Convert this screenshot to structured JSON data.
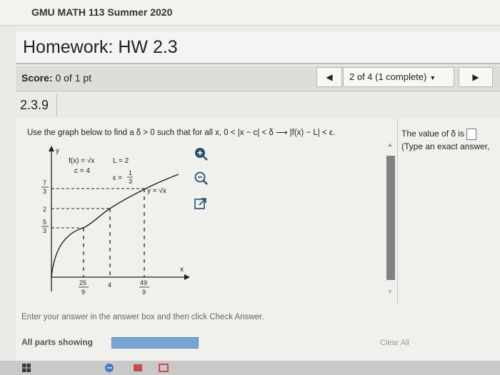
{
  "course": {
    "title": "GMU MATH 113 Summer 2020"
  },
  "homework": {
    "title": "Homework: HW 2.3"
  },
  "score": {
    "label": "Score:",
    "value": "0 of 1 pt",
    "progress_text": "2 of 4 (1 complete)"
  },
  "question": {
    "number": "2.3.9",
    "instruction": "Use the graph below to find a δ > 0 such that for all x, 0 < |x − c| < δ ⟶ |f(x) − L| < ε."
  },
  "graph": {
    "y_axis_label": "y",
    "x_axis_label": "x",
    "f_label": "f(x) = √x",
    "L_label": "L = 2",
    "c_label": "c = 4",
    "eps_prefix": "ε =",
    "eps_num": "1",
    "eps_den": "3",
    "curve_label": "y = √x",
    "y_ticks": [
      {
        "num": "7",
        "den": "3"
      },
      {
        "num": "2",
        "den": ""
      },
      {
        "num": "5",
        "den": "3"
      }
    ],
    "x_ticks": [
      {
        "num": "25",
        "den": "9"
      },
      {
        "num": "4",
        "den": ""
      },
      {
        "num": "49",
        "den": "9"
      }
    ]
  },
  "answer": {
    "prompt": "The value of δ is",
    "hint": "(Type an exact answer,"
  },
  "footer": {
    "enter_message": "Enter your answer in the answer box and then click Check Answer.",
    "parts_label": "All parts showing",
    "clear_all": "Clear All"
  },
  "colors": {
    "accent_blue": "#7aa3d6",
    "scroll_thumb": "#7f8185",
    "curve": "#222222"
  },
  "icons": [
    "zoom-in-icon",
    "zoom-out-icon",
    "popout-icon",
    "windows-start-icon",
    "edge-browser-icon"
  ]
}
